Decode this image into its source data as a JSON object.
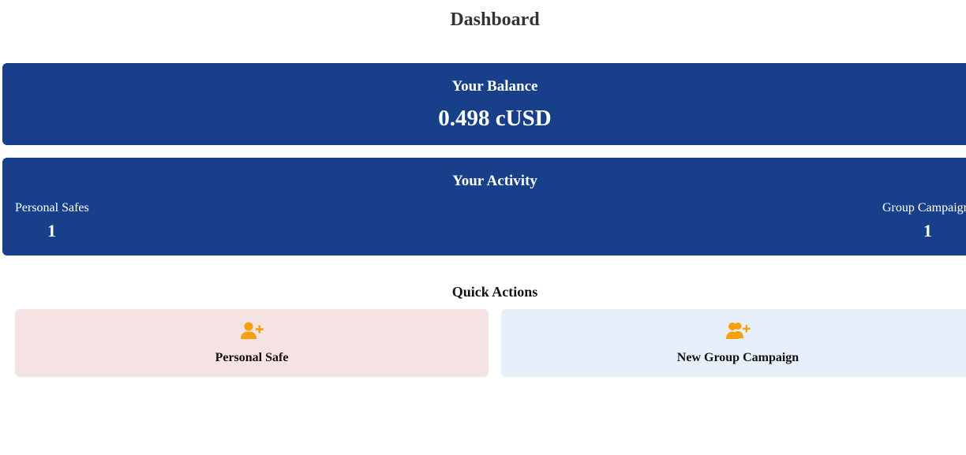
{
  "page": {
    "title": "Dashboard"
  },
  "balance": {
    "heading": "Your Balance",
    "amount": "0.498 cUSD"
  },
  "activity": {
    "heading": "Your Activity",
    "personal_safes": {
      "label": "Personal Safes",
      "value": "1"
    },
    "group_campaigns": {
      "label": "Group Campaigns",
      "value": "1"
    }
  },
  "quick_actions": {
    "heading": "Quick Actions",
    "personal_safe": {
      "label": "Personal Safe",
      "icon": "user-plus-icon"
    },
    "group_campaign": {
      "label": "New Group Campaign",
      "icon": "users-plus-icon"
    }
  },
  "colors": {
    "card_bg": "#183f8a",
    "icon_accent": "#f5a00f",
    "personal_action_bg": "#f5e3e4",
    "group_action_bg": "#e7f0fa"
  }
}
